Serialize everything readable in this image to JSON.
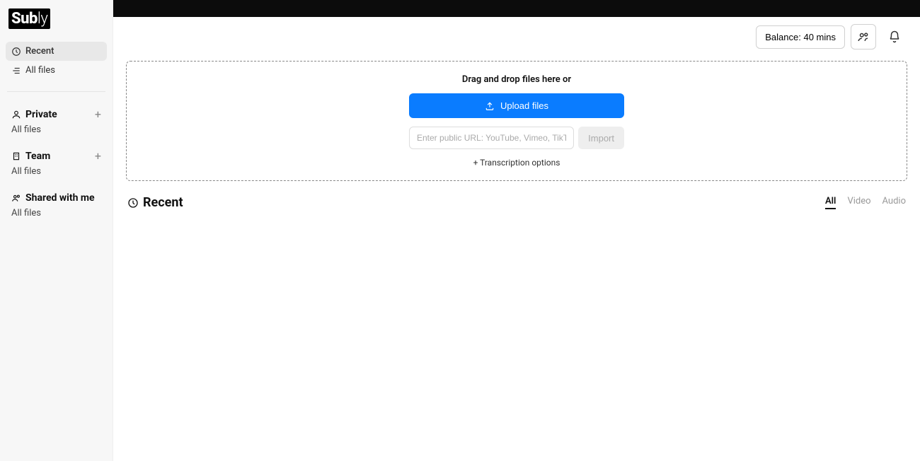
{
  "logo_text_a": "Sub",
  "logo_text_b": "ly",
  "sidebar": {
    "recent_label": "Recent",
    "allfiles_label": "All files",
    "private_title": "Private",
    "private_allfiles": "All files",
    "team_title": "Team",
    "team_allfiles": "All files",
    "shared_title": "Shared with me",
    "shared_allfiles": "All files"
  },
  "toolbar": {
    "balance_label": "Balance: 40 mins"
  },
  "dropzone": {
    "drag_text": "Drag and drop files here or",
    "upload_btn": "Upload files",
    "url_placeholder": "Enter public URL: YouTube, Vimeo, TikTok...",
    "import_btn": "Import",
    "options_link": "+ Transcription options"
  },
  "recent": {
    "title": "Recent"
  },
  "filters": {
    "all": "All",
    "video": "Video",
    "audio": "Audio"
  }
}
